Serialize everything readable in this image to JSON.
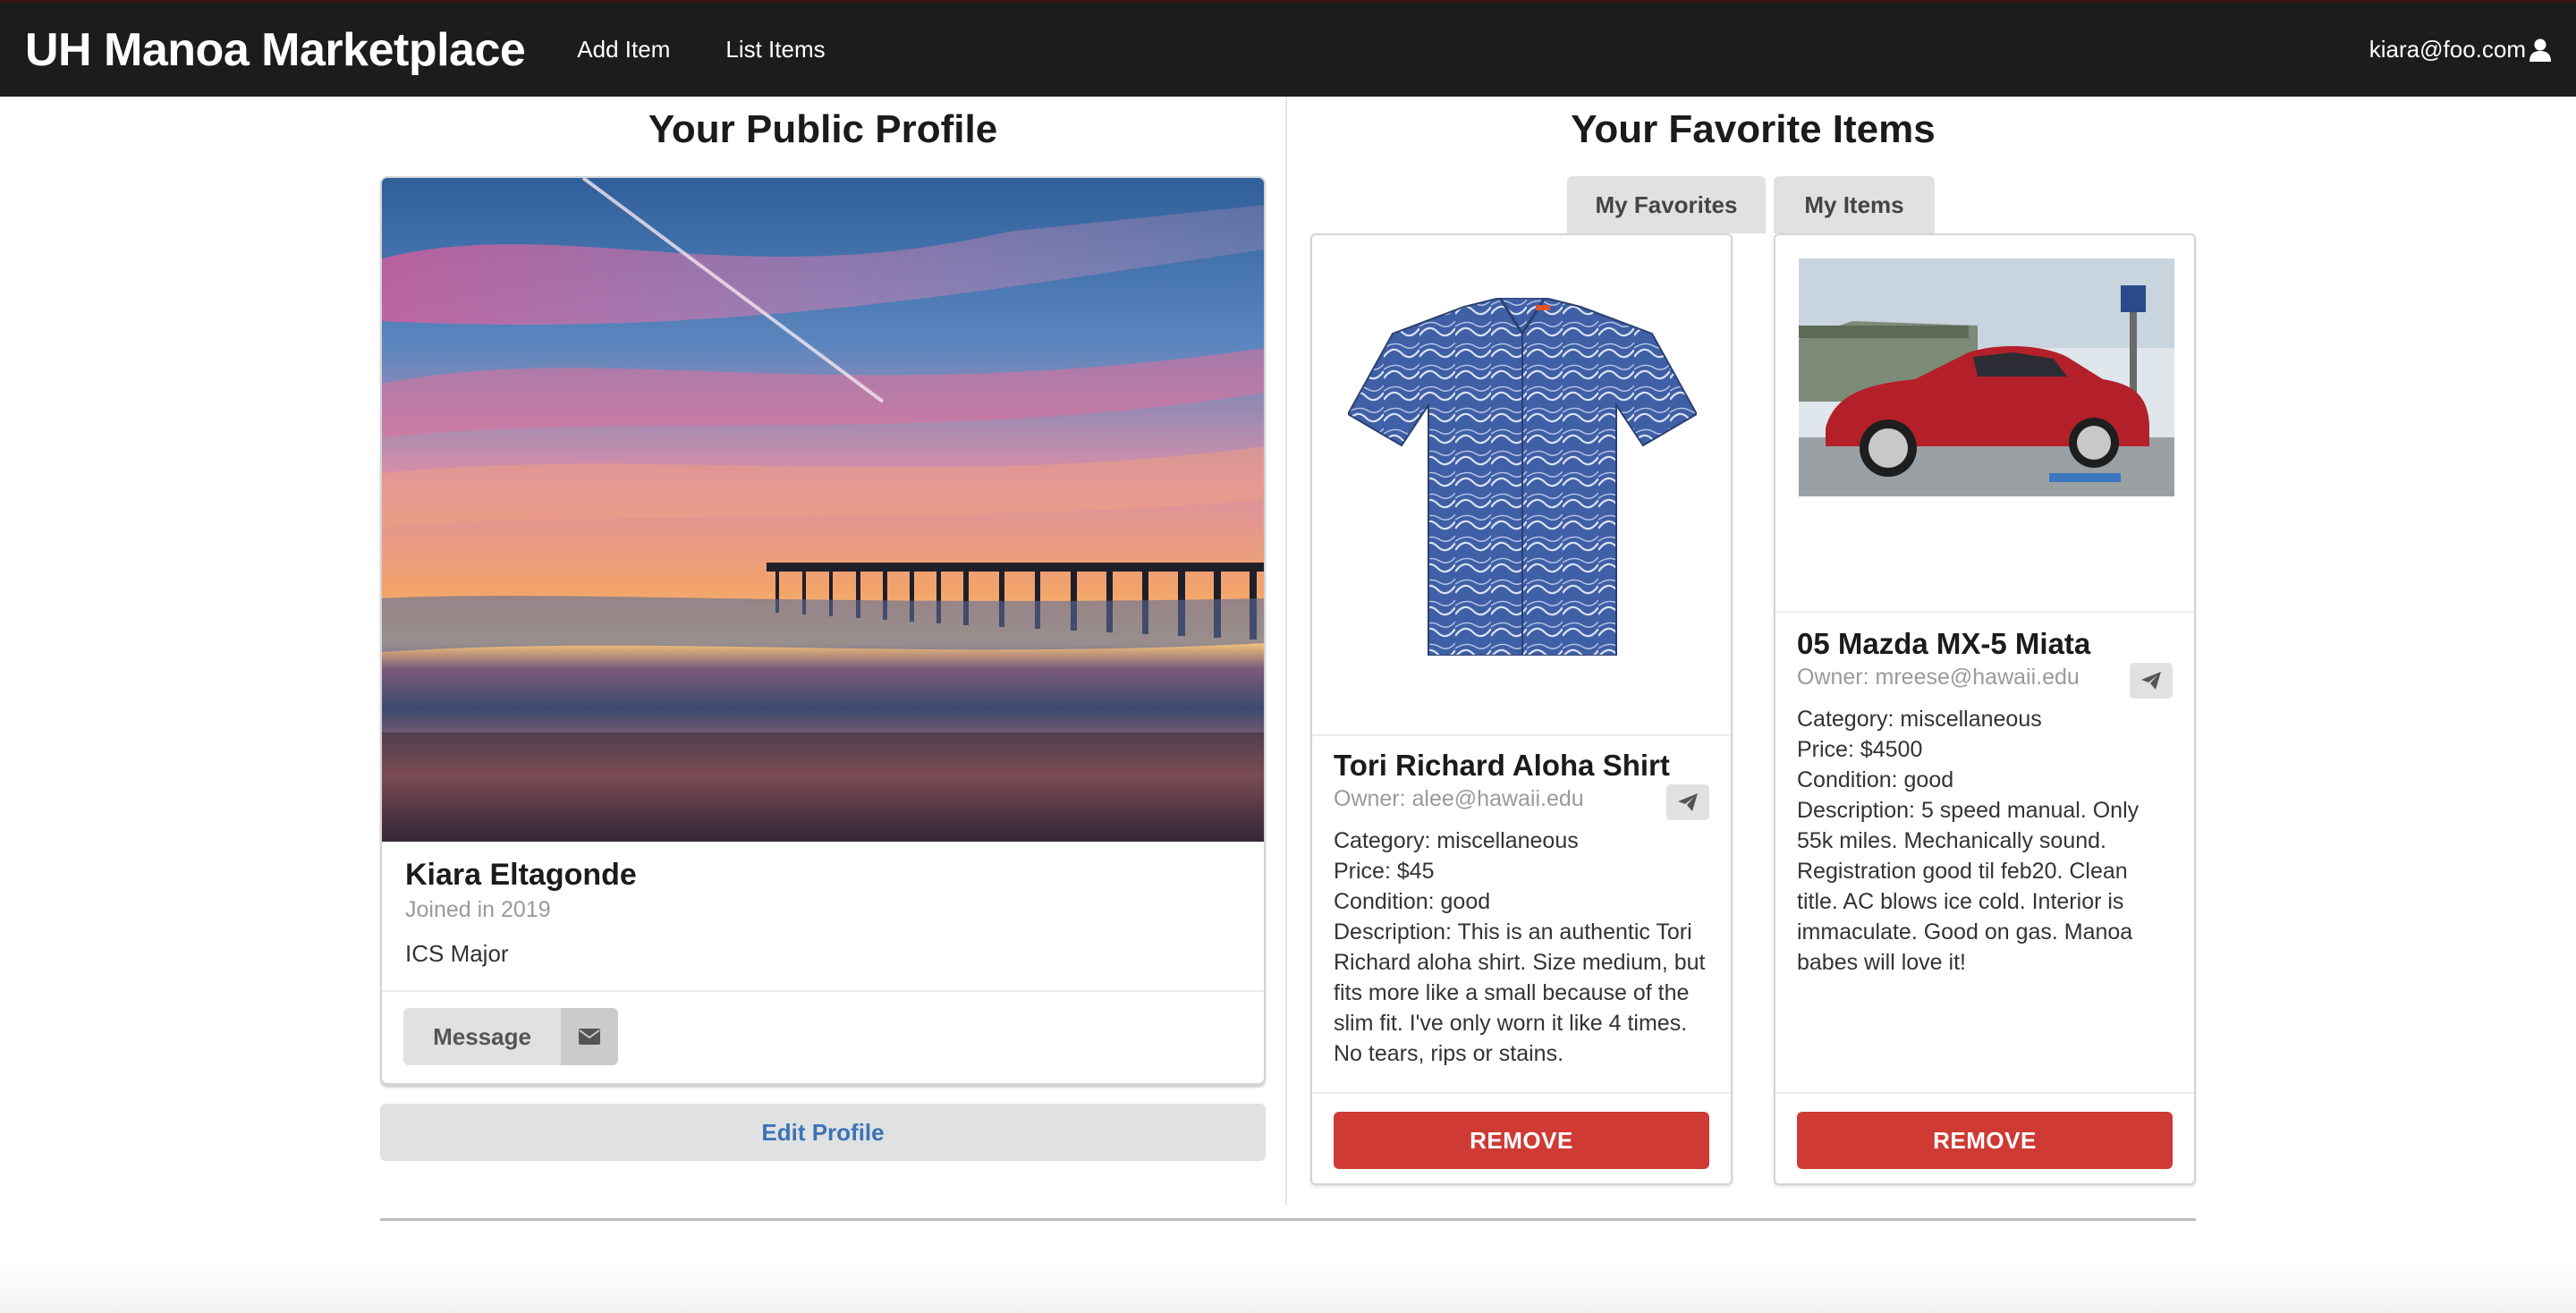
{
  "navbar": {
    "brand": "UH Manoa Marketplace",
    "links": [
      "Add Item",
      "List Items"
    ],
    "user_email": "kiara@foo.com",
    "user_icon": "user-icon"
  },
  "profile": {
    "section_title": "Your Public Profile",
    "name": "Kiara Eltagonde",
    "joined": "Joined in 2019",
    "description": "ICS Major",
    "image": "sunset-pier-photo",
    "message_label": "Message",
    "message_icon": "envelope-icon",
    "edit_label": "Edit Profile"
  },
  "favorites": {
    "section_title": "Your Favorite Items",
    "tabs": [
      "My Favorites",
      "My Items"
    ],
    "remove_label": "REMOVE",
    "send_icon": "paper-plane-icon",
    "items": [
      {
        "title": "Tori Richard Aloha Shirt",
        "owner": "Owner: alee@hawaii.edu",
        "category": "Category: miscellaneous",
        "price": "Price: $45",
        "condition": "Condition: good",
        "description": "Description: This is an authentic Tori Richard aloha shirt. Size medium, but fits more like a small because of the slim fit. I've only worn it like 4 times. No tears, rips or stains.",
        "image": "aloha-shirt-photo"
      },
      {
        "title": "05 Mazda MX-5 Miata",
        "owner": "Owner: mreese@hawaii.edu",
        "category": "Category: miscellaneous",
        "price": "Price: $4500",
        "condition": "Condition: good",
        "description": "Description: 5 speed manual. Only 55k miles. Mechanically sound. Registration good til feb20. Clean title. AC blows ice cold. Interior is immaculate. Good on gas. Manoa babes will love it!",
        "image": "red-miata-photo"
      }
    ]
  },
  "colors": {
    "navbar": "#1b1c1d",
    "remove": "#cf3a34",
    "edit_text": "#3b74b5",
    "button_grey": "#e0e1e2"
  }
}
